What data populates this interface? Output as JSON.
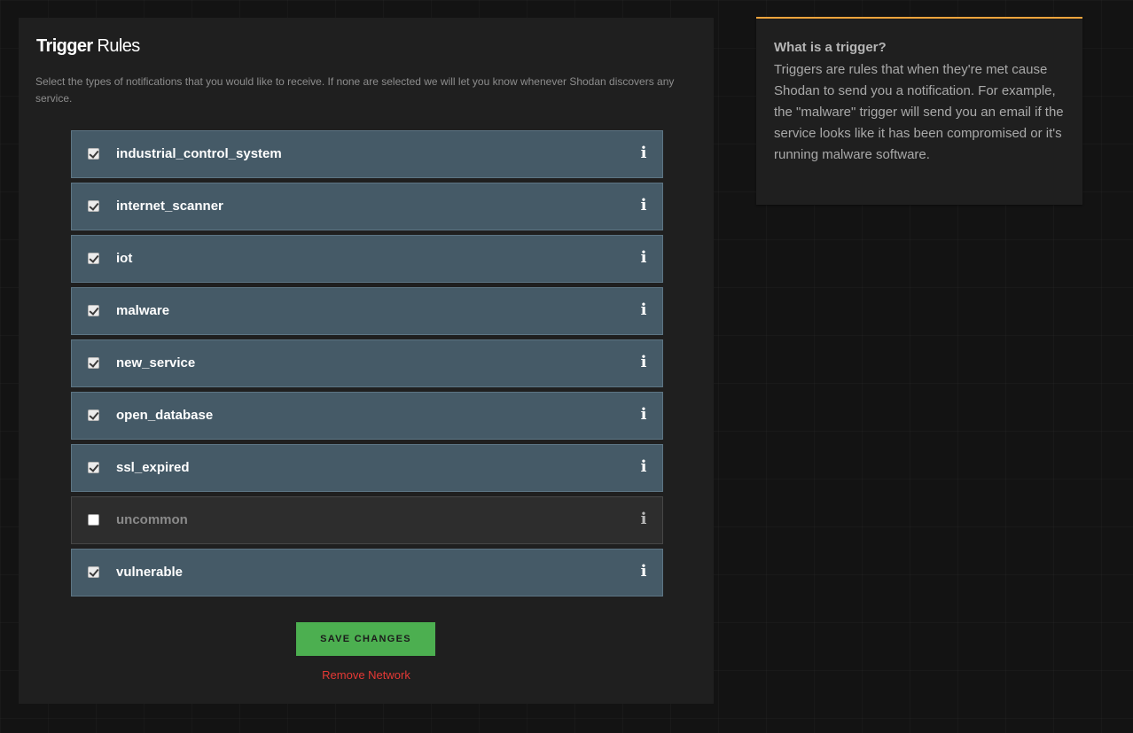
{
  "trigger_rules": {
    "title_bold": "Trigger",
    "title_rest": " Rules",
    "description": "Select the types of notifications that you would like to receive. If none are selected we will let you know whenever Shodan discovers any service.",
    "rules": [
      {
        "label": "industrial_control_system",
        "checked": true,
        "info_icon": "info-icon"
      },
      {
        "label": "internet_scanner",
        "checked": true,
        "info_icon": "info-icon"
      },
      {
        "label": "iot",
        "checked": true,
        "info_icon": "info-icon"
      },
      {
        "label": "malware",
        "checked": true,
        "info_icon": "info-icon"
      },
      {
        "label": "new_service",
        "checked": true,
        "info_icon": "info-icon"
      },
      {
        "label": "open_database",
        "checked": true,
        "info_icon": "info-icon"
      },
      {
        "label": "ssl_expired",
        "checked": true,
        "info_icon": "info-icon"
      },
      {
        "label": "uncommon",
        "checked": false,
        "info_icon": "info-icon"
      },
      {
        "label": "vulnerable",
        "checked": true,
        "info_icon": "info-icon"
      }
    ],
    "info_glyph": "i",
    "save_label": "SAVE CHANGES",
    "remove_label": "Remove Network"
  },
  "sidebar": {
    "heading": "What is a trigger?",
    "body": "Triggers are rules that when they're met cause Shodan to send you a notification. For example, the \"malware\" trigger will send you an email if the service looks like it has been compromised or it's running malware software."
  },
  "colors": {
    "page_background": "#131313",
    "panel_background": "#1f1f1f",
    "rule_checked_background": "#455a67",
    "rule_unchecked_background": "#2d2d2d",
    "save_button": "#4caf50",
    "remove_link": "#e53935",
    "sidebar_accent": "#f0a43c"
  }
}
